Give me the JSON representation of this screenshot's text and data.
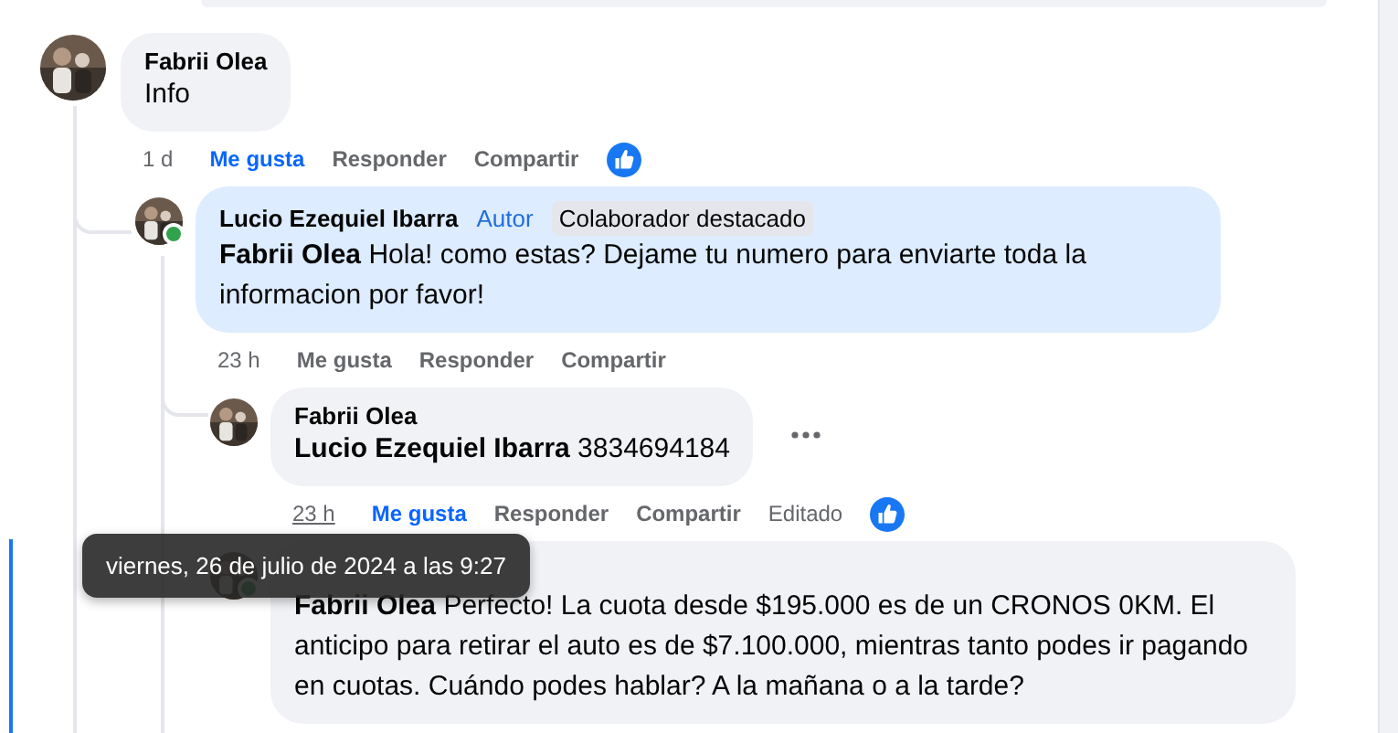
{
  "comments": [
    {
      "author": "Fabrii Olea",
      "body": "Info",
      "highlighted": false,
      "online": false,
      "more_menu": false,
      "actions": {
        "time": "1 d",
        "time_hovered": false,
        "like": "Me gusta",
        "liked": true,
        "reply": "Responder",
        "share": "Compartir",
        "reaction": true
      },
      "children": [
        {
          "author": "Lucio Ezequiel Ibarra",
          "badges": [
            {
              "kind": "author",
              "label": "Autor"
            },
            {
              "kind": "featured",
              "label": "Colaborador destacado"
            }
          ],
          "body": "**Fabrii Olea** Hola! como estas? Dejame tu numero para enviarte toda la informacion por favor!",
          "highlighted": true,
          "online": true,
          "more_menu": false,
          "actions": {
            "time": "23 h",
            "time_hovered": false,
            "like": "Me gusta",
            "liked": false,
            "reply": "Responder",
            "share": "Compartir",
            "reaction": false
          },
          "children": [
            {
              "author": "Fabrii Olea",
              "body": "**Lucio Ezequiel Ibarra** 3834694184",
              "highlighted": false,
              "online": false,
              "more_menu": true,
              "actions": {
                "time": "23 h",
                "time_hovered": true,
                "like": "Me gusta",
                "liked": true,
                "reply": "Responder",
                "share": "Compartir",
                "edited": "Editado",
                "reaction": true
              }
            },
            {
              "body": "**Fabrii Olea** Perfecto! La cuota desde $195.000 es de un CRONOS 0KM. El anticipo para retirar el auto es de $7.100.000, mientras tanto podes ir pagando en cuotas. Cuándo podes hablar? A la mañana o a la tarde?",
              "highlighted": false,
              "online": true,
              "more_menu": false
            }
          ]
        }
      ]
    }
  ],
  "tooltip": {
    "text": "viernes, 26 de julio de 2024 a las 9:27"
  }
}
